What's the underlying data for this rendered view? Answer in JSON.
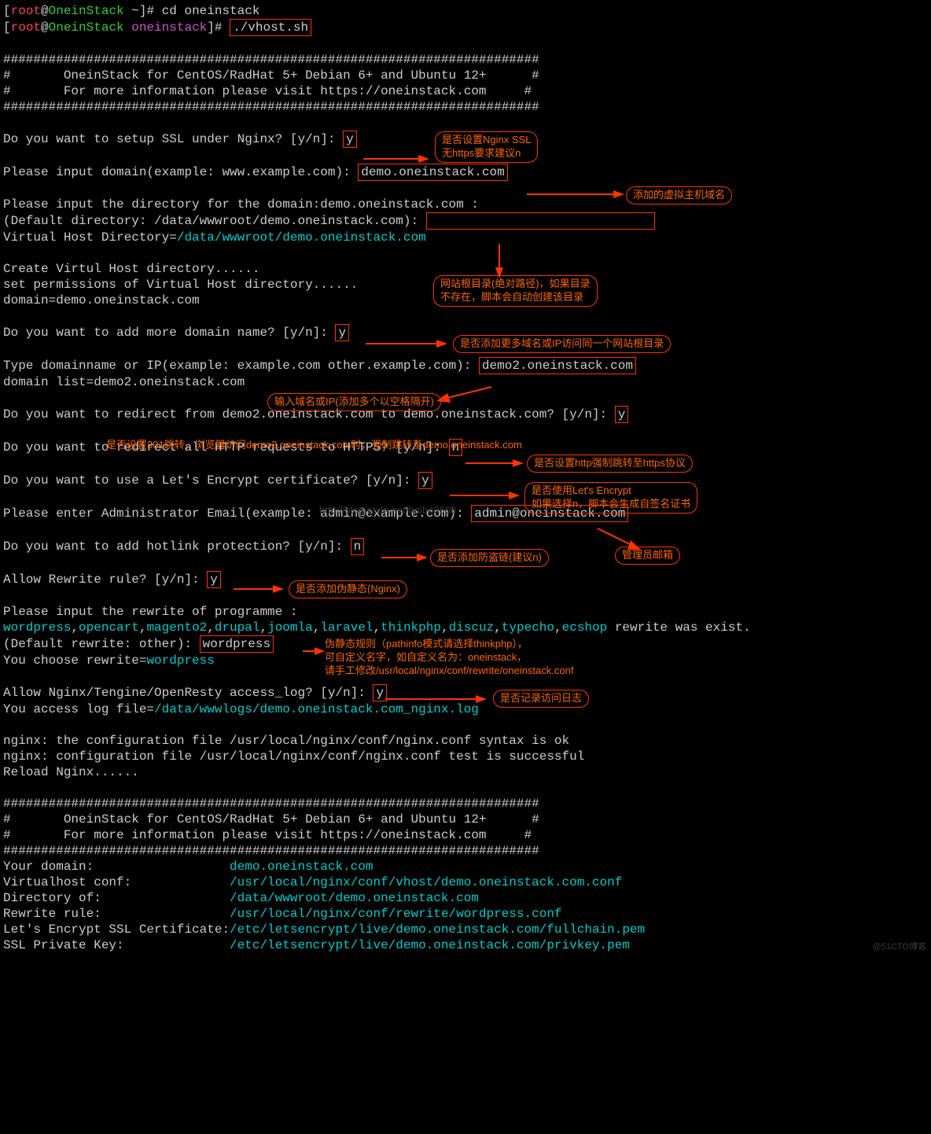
{
  "prompt": {
    "open_br": "[",
    "root": "root",
    "at": "@",
    "host": "OneinStack",
    "sep_home": " ~",
    "sep_dir": " ",
    "close_br": "]# ",
    "dir": "oneinstack",
    "cmd_cd": "cd oneinstack",
    "cmd_vhost": "./vhost.sh"
  },
  "banner": {
    "hash_line": "#######################################################################",
    "line1_pre": "#       ",
    "line1_txt": "OneinStack for CentOS/RadHat 5+ Debian 6+ and Ubuntu 12+",
    "line1_post": "      #",
    "line2_pre": "#       ",
    "line2_txt": "For more information please visit https://oneinstack.com",
    "line2_post": "     #"
  },
  "q_ssl": "Do you want to setup SSL under Nginx? [y/n]: ",
  "a_ssl": "y",
  "annot_ssl_l1": "是否设置Nginx SSL",
  "annot_ssl_l2": "无https要求建议n",
  "q_domain": "Please input domain(example: www.example.com): ",
  "a_domain": "demo.oneinstack.com",
  "annot_domain": "添加的虚拟主机域名",
  "q_dir_l1": "Please input the directory for the domain:demo.oneinstack.com :",
  "q_dir_l2": "(Default directory: /data/wwwroot/demo.oneinstack.com): ",
  "vhost_dir_label": "Virtual Host Directory=",
  "vhost_dir_value": "/data/wwwroot/demo.oneinstack.com",
  "annot_dir_l1": "网站根目录(绝对路径)，如果目录",
  "annot_dir_l2": "不存在，脚本会自动创建该目录",
  "create_l1": "Create Virtul Host directory......",
  "create_l2": "set permissions of Virtual Host directory......",
  "create_l3": "domain=demo.oneinstack.com",
  "q_more": "Do you want to add more domain name? [y/n]: ",
  "a_more": "y",
  "annot_more": "是否添加更多域名或IP访问同一个网站根目录",
  "q_more_domain": "Type domainname or IP(example: example.com other.example.com): ",
  "a_more_domain": "demo2.oneinstack.com",
  "domain_list": "domain list=demo2.oneinstack.com",
  "annot_more_domain": "输入域名或IP(添加多个以空格隔开)",
  "q_redirect": "Do you want to redirect from demo2.oneinstack.com to demo.oneinstack.com? [y/n]: ",
  "a_redirect": "y",
  "annot_redirect": "是否设置301跳转，浏览器访问demo2.oneinstack.com时，强制跳转至demo.oneinstack.com",
  "q_https": "Do you want to redirect all HTTP requests to HTTPS? [y/n]: ",
  "a_https": "n",
  "annot_https": "是否设置http强制跳转至https协议",
  "q_le": "Do you want to use a Let's Encrypt certificate? [y/n]: ",
  "a_le": "y",
  "annot_le_l1": "是否使用Let's Encrypt",
  "annot_le_l2": "如果选择n，脚本会生成自签名证书",
  "watermark_csdn": "http://blog.csdn.net/haibo0668",
  "q_email": "Please enter Administrator Email(example: admin@example.com): ",
  "a_email": "admin@oneinstack.com",
  "annot_email": "管理员邮箱",
  "q_hotlink": "Do you want to add hotlink protection? [y/n]: ",
  "a_hotlink": "n",
  "annot_hotlink": "是否添加防盗链(建议n)",
  "q_rewrite": "Allow Rewrite rule? [y/n]: ",
  "a_rewrite": "y",
  "annot_rewrite": "是否添加伪静态(Nginx)",
  "rewrite_intro": "Please input the rewrite of programme :",
  "rewrite_list_p1": "wordpress",
  "rewrite_list_p2": ",",
  "rewrite_list_p3": "opencart",
  "rewrite_list_p4": "magento2",
  "rewrite_list_p5": "drupal",
  "rewrite_list_p6": "joomla",
  "rewrite_list_p7": "laravel",
  "rewrite_list_p8": "thinkphp",
  "rewrite_list_p9": "discuz",
  "rewrite_list_p10": "typecho",
  "rewrite_list_p11": "ecshop",
  "rewrite_list_post": " rewrite was exist.",
  "rewrite_default": "(Default rewrite: other): ",
  "rewrite_choice": "wordpress",
  "rewrite_choose_pre": "You choose rewrite=",
  "rewrite_choose_val": "wordpress",
  "annot_rw_l1": "伪静态规则（pathinfo模式请选择thinkphp），",
  "annot_rw_l2": "可自定义名字，如自定义名为：oneinstack，",
  "annot_rw_l3": "请手工修改/usr/local/nginx/conf/rewrite/oneinstack.conf",
  "q_log": "Allow Nginx/Tengine/OpenResty access_log? [y/n]: ",
  "a_log": "y",
  "log_file_pre": "You access log file=",
  "log_file_val": "/data/wwwlogs/demo.oneinstack.com_nginx.log",
  "annot_log": "是否记录访问日志",
  "nginx_l1": "nginx: the configuration file /usr/local/nginx/conf/nginx.conf syntax is ok",
  "nginx_l2": "nginx: configuration file /usr/local/nginx/conf/nginx.conf test is successful",
  "nginx_l3": "Reload Nginx......",
  "summary": {
    "domain_label": "Your domain:                  ",
    "domain_value": "demo.oneinstack.com",
    "vconf_label": "Virtualhost conf:             ",
    "vconf_value": "/usr/local/nginx/conf/vhost/demo.oneinstack.com.conf",
    "dirof_label": "Directory of:                 ",
    "dirof_value": "/data/wwwroot/demo.oneinstack.com",
    "rw_label": "Rewrite rule:                 ",
    "rw_value": "/usr/local/nginx/conf/rewrite/wordpress.conf",
    "ssl_label": "Let's Encrypt SSL Certificate:",
    "ssl_value": "/etc/letsencrypt/live/demo.oneinstack.com/fullchain.pem",
    "key_label": "SSL Private Key:              ",
    "key_value": "/etc/letsencrypt/live/demo.oneinstack.com/privkey.pem"
  },
  "watermark_51cto": "@51CTO博客"
}
